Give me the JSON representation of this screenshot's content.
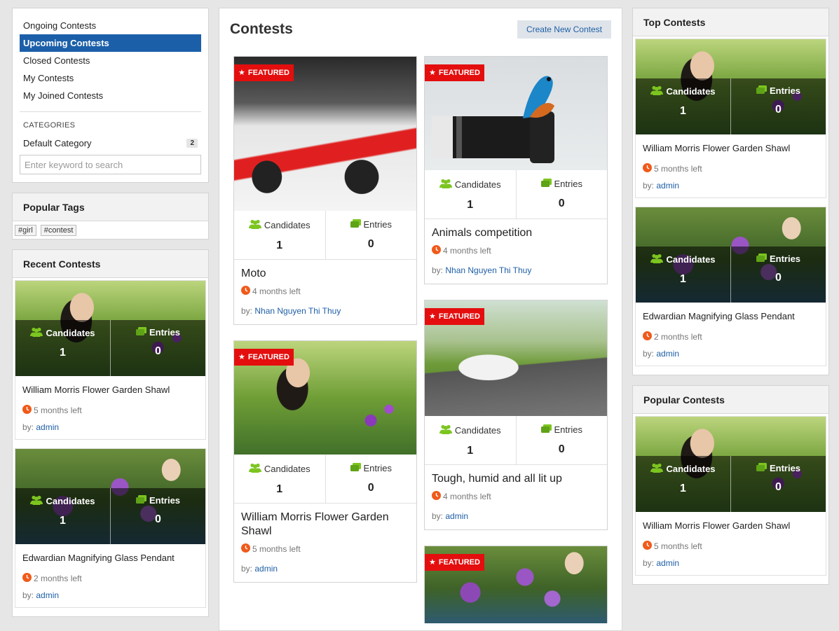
{
  "left_menu": {
    "items": [
      {
        "label": "Ongoing Contests",
        "active": false
      },
      {
        "label": "Upcoming Contests",
        "active": true
      },
      {
        "label": "Closed Contests",
        "active": false
      },
      {
        "label": "My Contests",
        "active": false
      },
      {
        "label": "My Joined Contests",
        "active": false
      }
    ],
    "categories_heading": "CATEGORIES",
    "categories": [
      {
        "label": "Default Category",
        "count": "2"
      }
    ],
    "search_placeholder": "Enter keyword to search"
  },
  "popular_tags": {
    "title": "Popular Tags",
    "tags": [
      "#girl",
      "#contest"
    ]
  },
  "recent_contests": {
    "title": "Recent Contests",
    "items": [
      {
        "title": "William Morris Flower Garden Shawl",
        "candidates_label": "Candidates",
        "candidates": "1",
        "entries_label": "Entries",
        "entries": "0",
        "time_left": "5 months left",
        "by_label": "by:",
        "author": "admin"
      },
      {
        "title": "Edwardian Magnifying Glass Pendant",
        "candidates_label": "Candidates",
        "candidates": "1",
        "entries_label": "Entries",
        "entries": "0",
        "time_left": "2 months left",
        "by_label": "by:",
        "author": "admin"
      }
    ]
  },
  "main": {
    "title": "Contests",
    "create_label": "Create New Contest",
    "featured_label": "FEATURED",
    "cards": [
      {
        "title": "Moto",
        "candidates_label": "Candidates",
        "candidates": "1",
        "entries_label": "Entries",
        "entries": "0",
        "time_left": "4 months left",
        "by_label": "by:",
        "author": "Nhan Nguyen Thi Thuy"
      },
      {
        "title": "Animals competition",
        "candidates_label": "Candidates",
        "candidates": "1",
        "entries_label": "Entries",
        "entries": "0",
        "time_left": "4 months left",
        "by_label": "by:",
        "author": "Nhan Nguyen Thi Thuy"
      },
      {
        "title": "William Morris Flower Garden Shawl",
        "candidates_label": "Candidates",
        "candidates": "1",
        "entries_label": "Entries",
        "entries": "0",
        "time_left": "5 months left",
        "by_label": "by:",
        "author": "admin"
      },
      {
        "title": "Tough, humid and all lit up",
        "candidates_label": "Candidates",
        "candidates": "1",
        "entries_label": "Entries",
        "entries": "0",
        "time_left": "4 months left",
        "by_label": "by:",
        "author": "admin"
      }
    ]
  },
  "top_contests": {
    "title": "Top Contests",
    "items": [
      {
        "title": "William Morris Flower Garden Shawl",
        "candidates_label": "Candidates",
        "candidates": "1",
        "entries_label": "Entries",
        "entries": "0",
        "time_left": "5 months left",
        "by_label": "by:",
        "author": "admin"
      },
      {
        "title": "Edwardian Magnifying Glass Pendant",
        "candidates_label": "Candidates",
        "candidates": "1",
        "entries_label": "Entries",
        "entries": "0",
        "time_left": "2 months left",
        "by_label": "by:",
        "author": "admin"
      }
    ]
  },
  "popular_contests": {
    "title": "Popular Contests",
    "items": [
      {
        "title": "William Morris Flower Garden Shawl",
        "candidates_label": "Candidates",
        "candidates": "1",
        "entries_label": "Entries",
        "entries": "0",
        "time_left": "5 months left",
        "by_label": "by:",
        "author": "admin"
      }
    ]
  },
  "colors": {
    "accent": "#1c5fa9",
    "featured": "#e40e0e",
    "candidates_icon": "#7cc520",
    "clock_icon": "#f05a1a"
  },
  "icons": {
    "candidates": "people-icon",
    "entries": "photo-icon",
    "time": "clock-icon",
    "featured": "star-icon"
  }
}
